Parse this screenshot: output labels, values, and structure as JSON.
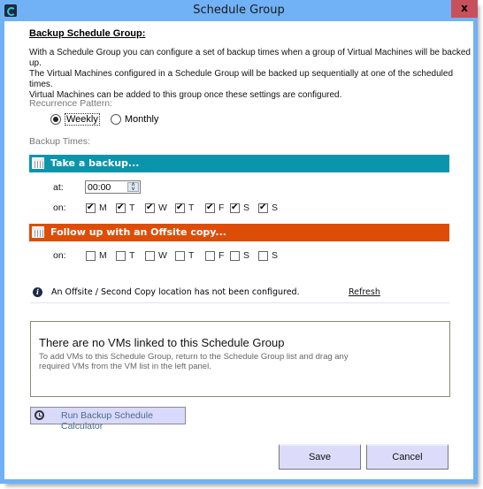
{
  "window": {
    "title": "Schedule Group",
    "close_label": "x",
    "app_icon": "app-logo-icon"
  },
  "header": {
    "heading": "Backup Schedule Group:",
    "intro_lines": [
      "With a Schedule Group you can configure a set of backup times when a group of Virtual Machines will be backed up.",
      "The Virtual Machines configured in a Schedule Group will be backed up sequentially at one of the scheduled times.",
      "Virtual Machines can be added to this group once these settings are configured."
    ]
  },
  "recurrence": {
    "label": "Recurrence Pattern:",
    "options": [
      {
        "label": "Weekly",
        "selected": true
      },
      {
        "label": "Monthly",
        "selected": false
      }
    ]
  },
  "backup_times": {
    "label": "Backup Times:",
    "take_backup": {
      "title": "Take a backup...",
      "color": "#0a95ad",
      "at_label": "at:",
      "time_value": "00:00",
      "on_label": "on:",
      "days": [
        {
          "label": "M",
          "checked": true
        },
        {
          "label": "T",
          "checked": true
        },
        {
          "label": "W",
          "checked": true
        },
        {
          "label": "T",
          "checked": true
        },
        {
          "label": "F",
          "checked": true
        },
        {
          "label": "S",
          "checked": true
        },
        {
          "label": "S",
          "checked": true
        }
      ]
    },
    "offsite": {
      "title": "Follow up with an Offsite copy...",
      "color": "#de4d07",
      "on_label": "on:",
      "days": [
        {
          "label": "M",
          "checked": false
        },
        {
          "label": "T",
          "checked": false
        },
        {
          "label": "W",
          "checked": false
        },
        {
          "label": "T",
          "checked": false
        },
        {
          "label": "F",
          "checked": false
        },
        {
          "label": "S",
          "checked": false
        },
        {
          "label": "S",
          "checked": false
        }
      ]
    }
  },
  "info": {
    "icon": "info-icon",
    "message": "An Offsite / Second Copy location has not been configured.",
    "refresh_label": "Refresh"
  },
  "vm_panel": {
    "title": "There are no VMs linked to this Schedule Group",
    "desc_lines": [
      "To add VMs to this Schedule Group, return to the Schedule Group list and drag any",
      "required VMs from the VM list in the left panel."
    ]
  },
  "calculator": {
    "icon": "clock-icon",
    "label": "Run Backup Schedule Calculator"
  },
  "footer": {
    "save_label": "Save",
    "cancel_label": "Cancel"
  }
}
